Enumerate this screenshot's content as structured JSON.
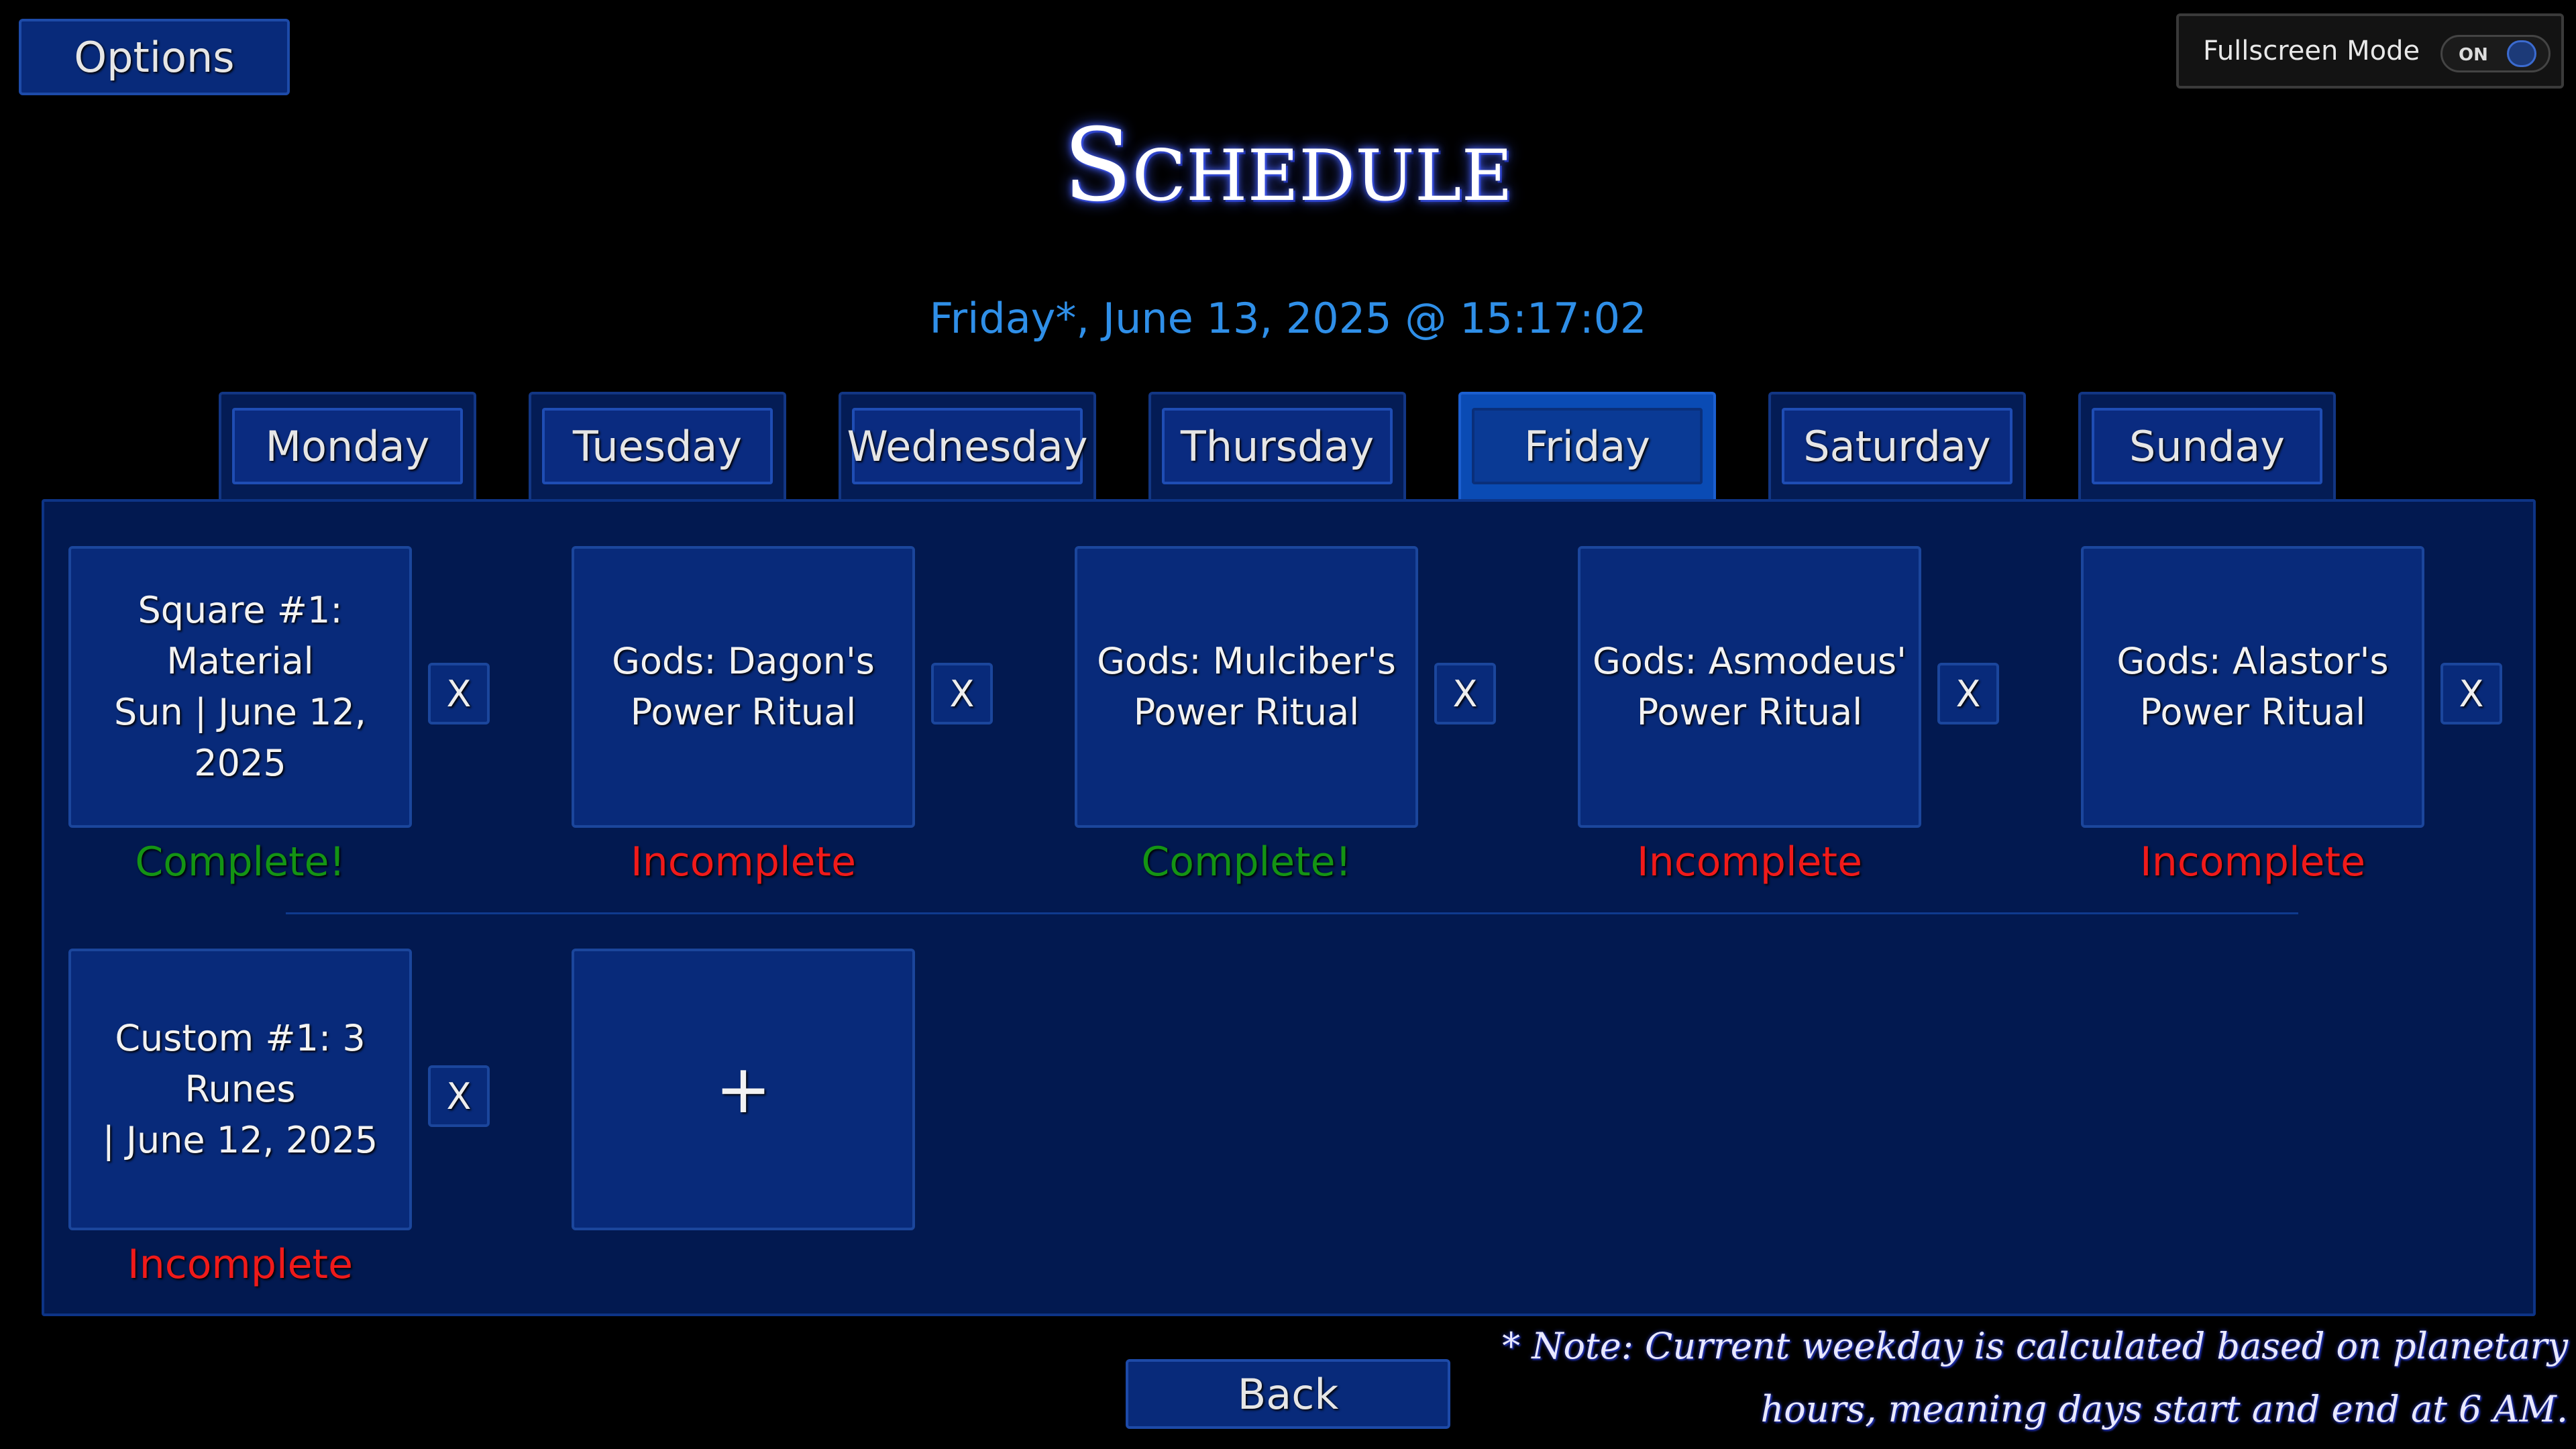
{
  "header": {
    "options_label": "Options",
    "fullscreen_label": "Fullscreen Mode",
    "fullscreen_state": "ON",
    "title": "Schedule",
    "datetime": "Friday*, June 13, 2025 @ 15:17:02"
  },
  "tabs": [
    {
      "label": "Monday",
      "active": false
    },
    {
      "label": "Tuesday",
      "active": false
    },
    {
      "label": "Wednesday",
      "active": false
    },
    {
      "label": "Thursday",
      "active": false
    },
    {
      "label": "Friday",
      "active": true
    },
    {
      "label": "Saturday",
      "active": false
    },
    {
      "label": "Sunday",
      "active": false
    }
  ],
  "tasks": [
    {
      "line1": "Square #1: Material",
      "line2": "Sun | June 12, 2025",
      "remove_label": "X",
      "status": "Complete!"
    },
    {
      "line1": "Gods: Dagon's",
      "line2": "Power Ritual",
      "remove_label": "X",
      "status": "Incomplete"
    },
    {
      "line1": "Gods: Mulciber's",
      "line2": "Power Ritual",
      "remove_label": "X",
      "status": "Complete!"
    },
    {
      "line1": "Gods: Asmodeus'",
      "line2": "Power Ritual",
      "remove_label": "X",
      "status": "Incomplete"
    },
    {
      "line1": "Gods: Alastor's",
      "line2": "Power Ritual",
      "remove_label": "X",
      "status": "Incomplete"
    },
    {
      "line1": "Custom #1: 3 Runes",
      "line2": "| June 12, 2025",
      "remove_label": "X",
      "status": "Incomplete"
    }
  ],
  "add_label": "+",
  "back_label": "Back",
  "note": {
    "line1": "* Note: Current weekday is calculated based on planetary",
    "line2": "hours, meaning days start and end at 6 AM."
  },
  "colors": {
    "complete": "#149414",
    "incomplete": "#f01a1a",
    "accent": "#2f8fe8"
  }
}
